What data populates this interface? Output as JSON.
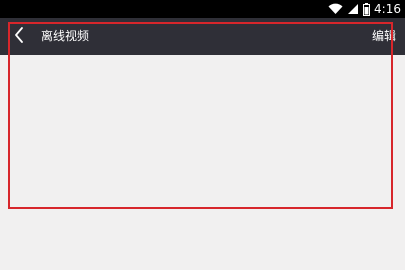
{
  "status_bar": {
    "time": "4:16",
    "icons": [
      "wifi-icon",
      "signal-icon",
      "battery-icon"
    ]
  },
  "app_bar": {
    "back_icon": "chevron-left-icon",
    "title": "离线视频",
    "edit_label": "编辑"
  },
  "colors": {
    "status_bar_bg": "#000000",
    "app_bar_bg": "#2f2f37",
    "content_bg": "#f1f0f0",
    "highlight_border": "#d7262b"
  }
}
